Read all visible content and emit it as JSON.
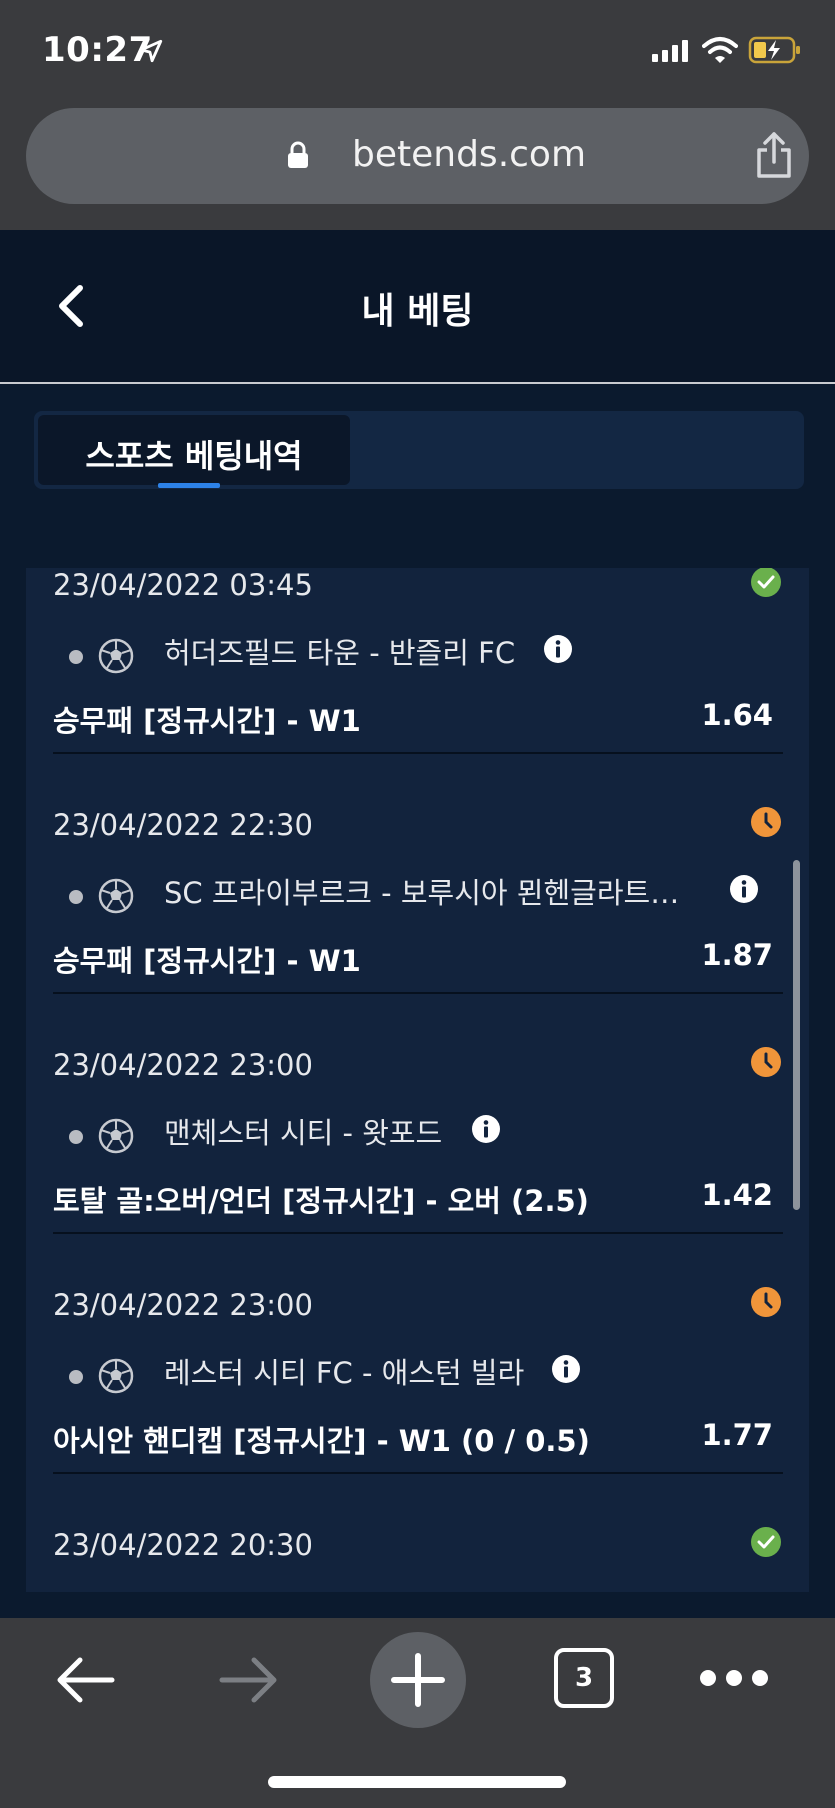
{
  "status_bar": {
    "time": "10:27"
  },
  "browser": {
    "url": "betends.com",
    "tab_count": "3"
  },
  "header": {
    "title": "내 베팅"
  },
  "tabs": [
    {
      "label": "스포츠 베팅내역",
      "active": true
    }
  ],
  "bets": [
    {
      "date": "23/04/2022 03:45",
      "status": "won",
      "match": "허더즈필드 타운 - 반즐리 FC",
      "market": "승무패 [정규시간] - W1",
      "odds": "1.64"
    },
    {
      "date": "23/04/2022 22:30",
      "status": "pending",
      "match": "SC 프라이부르크 - 보루시아 묀헨글라트…",
      "market": "승무패 [정규시간] - W1",
      "odds": "1.87"
    },
    {
      "date": "23/04/2022 23:00",
      "status": "pending",
      "match": "맨체스터 시티 - 왓포드",
      "market": "토탈 골:오버/언더 [정규시간] - 오버 (2.5)",
      "odds": "1.42"
    },
    {
      "date": "23/04/2022 23:00",
      "status": "pending",
      "match": "레스터 시티 FC - 애스턴 빌라",
      "market": "아시안 핸디캡 [정규시간] - W1 (0 / 0.5)",
      "odds": "1.77"
    },
    {
      "date": "23/04/2022 20:30",
      "status": "won"
    }
  ],
  "colors": {
    "won": "#6ab04c",
    "pending": "#f0953a",
    "accent": "#2d82e8"
  },
  "icons": {
    "status_won": "check-circle-icon",
    "status_pending": "clock-icon",
    "sport": "soccer-ball-icon",
    "info": "info-icon"
  }
}
